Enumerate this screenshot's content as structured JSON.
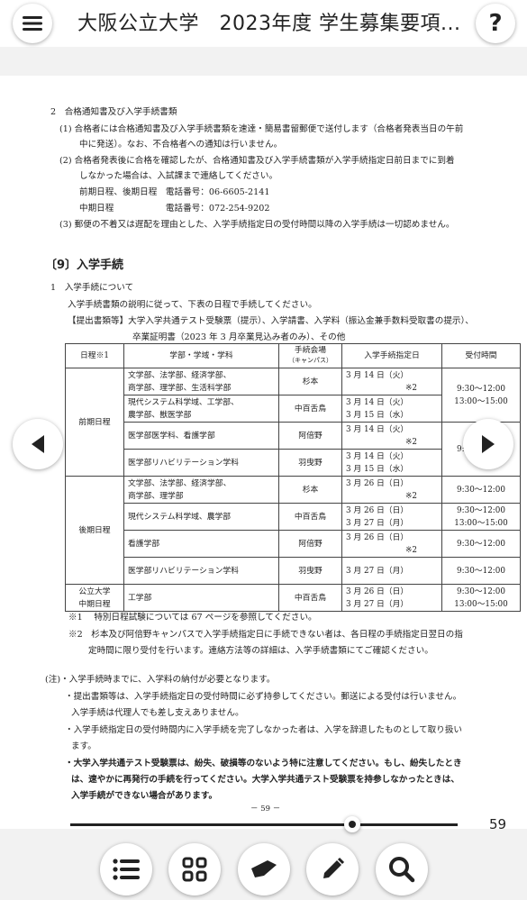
{
  "header": {
    "title": "大阪公立大学　2023年度 学生募集要項...",
    "help_label": "?"
  },
  "doc": {
    "sec2_title": "2　合格通知書及び入学手続書類",
    "sec2_p1a": "(1)  合格者には合格通知書及び入学手続書類を速達・簡易書留郵便で送付します（合格者発表当日の午前",
    "sec2_p1b": "中に発送）。なお、不合格者への通知は行いません。",
    "sec2_p2a": "(2)  合格者発表後に合格を確認したが、合格通知書及び入学手続書類が入学手続指定日前日までに到着",
    "sec2_p2b": "しなかった場合は、入試課まで連絡してください。",
    "sec2_tel1": "前期日程、後期日程　電話番号：06-6605-2141",
    "sec2_tel2": "中期日程　　　　　　電話番号：072-254-9202",
    "sec2_p3": "(3)  郵便の不着又は遅配を理由とした、入学手続指定日の受付時間以降の入学手続は一切認めません。",
    "sec9_title": "〔9〕入学手続",
    "s1_title": "1　入学手続について",
    "s1_l1": "入学手続書類の説明に従って、下表の日程で手続してください。",
    "s1_l2": "【提出書類等】大学入学共通テスト受験票（提示）、入学請書、入学料（振込金兼手数料受取書の提示）、",
    "s1_l3": "卒業証明書（2023 年 3 月卒業見込み者のみ）、その他",
    "note1": "※1　 特別日程試験については 67 ページを参照してください。",
    "note2a": "※2　杉本及び阿倍野キャンパスで入学手続指定日に手続できない者は、各日程の手続指定日翌日の指",
    "note2b": "定時間に限り受付を行います。連絡方法等の詳細は、入学手続書類にてご確認ください。",
    "n_a": "(注)・入学手続時までに、入学料の納付が必要となります。",
    "n_b1": "・提出書類等は、入学手続指定日の受付時間に必ず持参してください。郵送による受付は行いません。",
    "n_b2": "入学手続は代理人でも差し支えありません。",
    "n_c1": "・入学手続指定日の受付時間内に入学手続を完了しなかった者は、入学を辞退したものとして取り扱い",
    "n_c2": "ます。",
    "n_d1": "・大学入学共通テスト受験票は、紛失、破損等のないよう特に注意してください。もし、紛失したとき",
    "n_d2": "は、速やかに再発行の手続を行ってください。大学入学共通テスト受験票を持参しなかったときは、",
    "n_d3": "入学手続ができない場合があります。",
    "footer": "－ 59 －"
  },
  "table": {
    "headers": {
      "schedule": "日程※1",
      "faculty": "学部・学域・学科",
      "campus_a": "手続会場",
      "campus_b": "（キャンパス）",
      "date": "入学手続指定日",
      "time": "受付時間"
    },
    "groups": {
      "zenki": "前期日程",
      "kouki": "後期日程",
      "chuki_a": "公立大学",
      "chuki_b": "中期日程"
    },
    "rows": [
      {
        "f1": "文学部、法学部、経済学部、",
        "f2": "商学部、理学部、生活科学部",
        "campus": "杉本",
        "d1": "3 月 14 日（火）",
        "d2": "※2",
        "t1": "",
        "t2": ""
      },
      {
        "f1": "現代システム科学域、工学部、",
        "f2": "農学部、獣医学部",
        "campus": "中百舌鳥",
        "d1": "3 月 14 日（火）",
        "d2": "3 月 15 日（水）",
        "t1": "9:30～12:00",
        "t2": "13:00～15:00"
      },
      {
        "f1": "医学部医学科、看護学部",
        "f2": "",
        "campus": "阿倍野",
        "d1": "3 月 14 日（火）",
        "d2": "※2",
        "t1": "",
        "t2": ""
      },
      {
        "f1": "医学部リハビリテーション学科",
        "f2": "",
        "campus": "羽曳野",
        "d1": "3 月 14 日（火）",
        "d2": "3 月 15 日（水）",
        "t1": "9:30～12:00",
        "t2": ""
      },
      {
        "f1": "文学部、法学部、経済学部、",
        "f2": "商学部、理学部",
        "campus": "杉本",
        "d1": "3 月 26 日（日）",
        "d2": "※2",
        "t1": "9:30～12:00",
        "t2": ""
      },
      {
        "f1": "現代システム科学域、農学部",
        "f2": "",
        "campus": "中百舌鳥",
        "d1": "3 月 26 日（日）",
        "d2": "3 月 27 日（月）",
        "t1": "9:30～12:00",
        "t2": "13:00～15:00"
      },
      {
        "f1": "看護学部",
        "f2": "",
        "campus": "阿倍野",
        "d1": "3 月 26 日（日）",
        "d2": "※2",
        "t1": "9:30～12:00",
        "t2": ""
      },
      {
        "f1": "医学部リハビリテーション学科",
        "f2": "",
        "campus": "羽曳野",
        "d1": "3 月 27 日（月）",
        "d2": "",
        "t1": "9:30～12:00",
        "t2": ""
      },
      {
        "f1": "工学部",
        "f2": "",
        "campus": "中百舌鳥",
        "d1": "3 月 26 日（日）",
        "d2": "3 月 27 日（月）",
        "t1": "9:30～12:00",
        "t2": "13:00～15:00"
      }
    ]
  },
  "viewer": {
    "page_number": "59",
    "progress": 0.73
  }
}
